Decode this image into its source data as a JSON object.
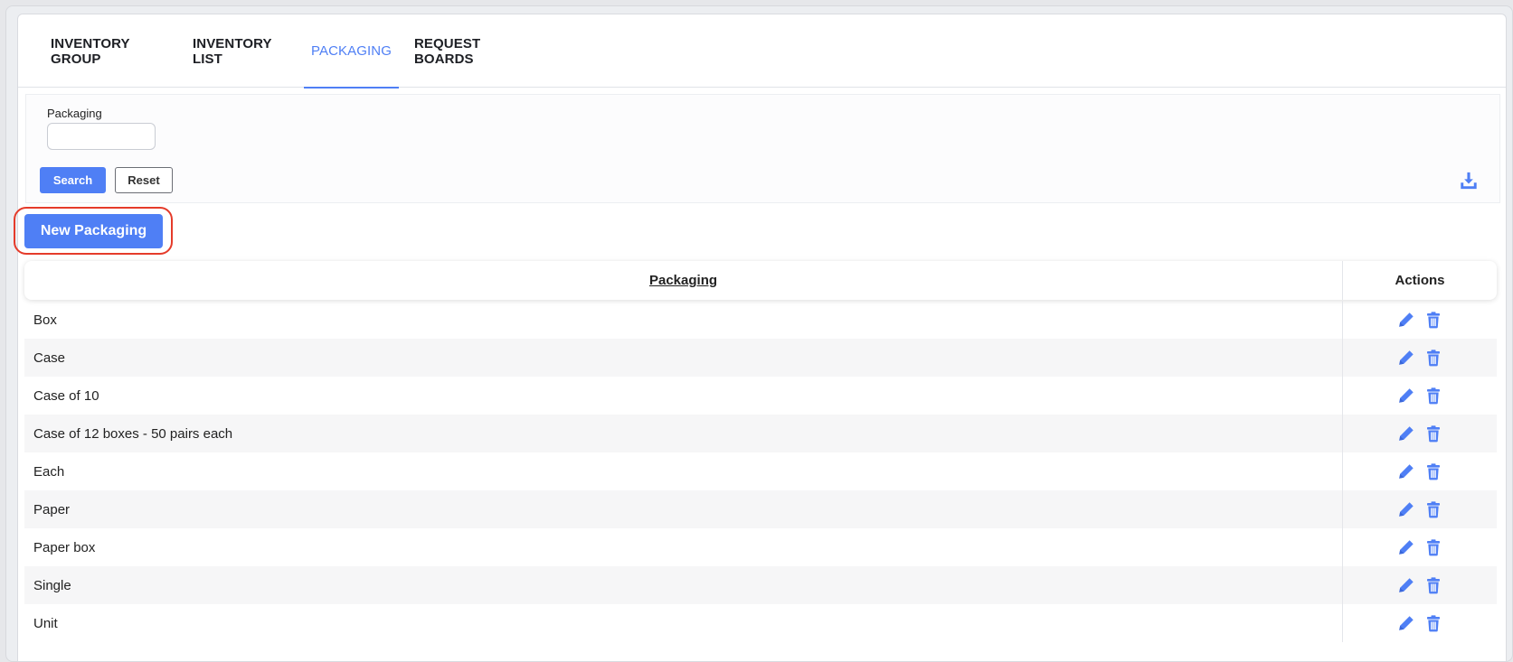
{
  "tabs": [
    {
      "label": "INVENTORY GROUP",
      "active": false
    },
    {
      "label": "INVENTORY LIST",
      "active": false
    },
    {
      "label": "PACKAGING",
      "active": true
    },
    {
      "label": "REQUEST BOARDS",
      "active": false
    }
  ],
  "filter": {
    "label": "Packaging",
    "value": "",
    "search_label": "Search",
    "reset_label": "Reset"
  },
  "new_button_label": "New Packaging",
  "table": {
    "columns": [
      "Packaging",
      "Actions"
    ],
    "rows": [
      "Box",
      "Case",
      "Case of 10",
      "Case of 12 boxes - 50 pairs each",
      "Each",
      "Paper",
      "Paper box",
      "Single",
      "Unit"
    ]
  },
  "colors": {
    "accent": "#4f7ff5",
    "highlight": "#e53b2a"
  },
  "icons": {
    "download": "download-icon",
    "edit": "pencil-icon",
    "delete": "trash-icon"
  }
}
